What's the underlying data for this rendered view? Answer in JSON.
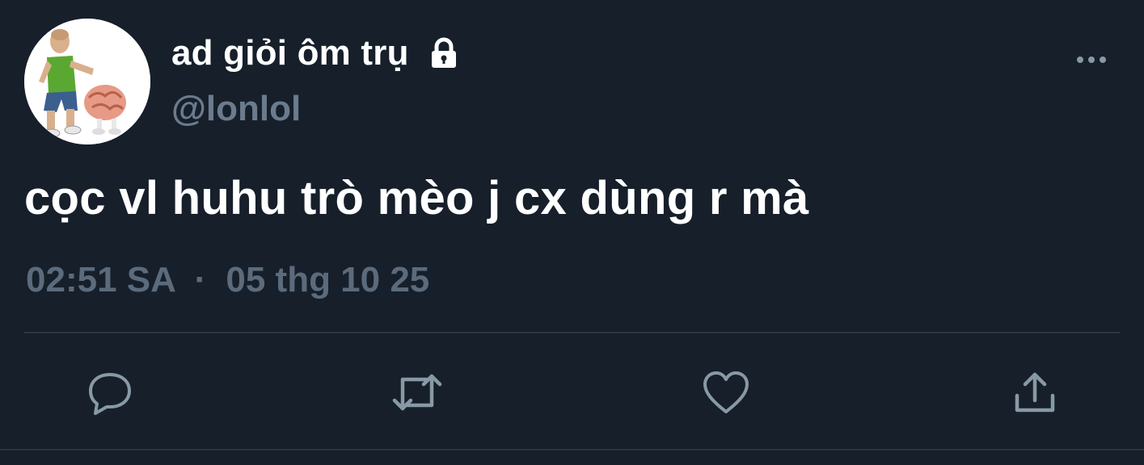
{
  "user": {
    "display_name": "ad giỏi ôm trụ",
    "handle": "@lonlol",
    "protected_icon": "lock-icon"
  },
  "tweet": {
    "text": "cọc vl huhu trò mèo j cx dùng r mà",
    "time": "02:51 SA",
    "separator": "·",
    "date": "05 thg 10 25"
  },
  "actions": {
    "reply_icon": "reply-icon",
    "retweet_icon": "retweet-icon",
    "like_icon": "like-icon",
    "share_icon": "share-icon",
    "more_icon": "more-icon"
  },
  "colors": {
    "background": "#161f2a",
    "primary_text": "#ffffff",
    "secondary_text": "#6b7b8d",
    "icon": "#8899a6",
    "divider": "#2a3644"
  }
}
